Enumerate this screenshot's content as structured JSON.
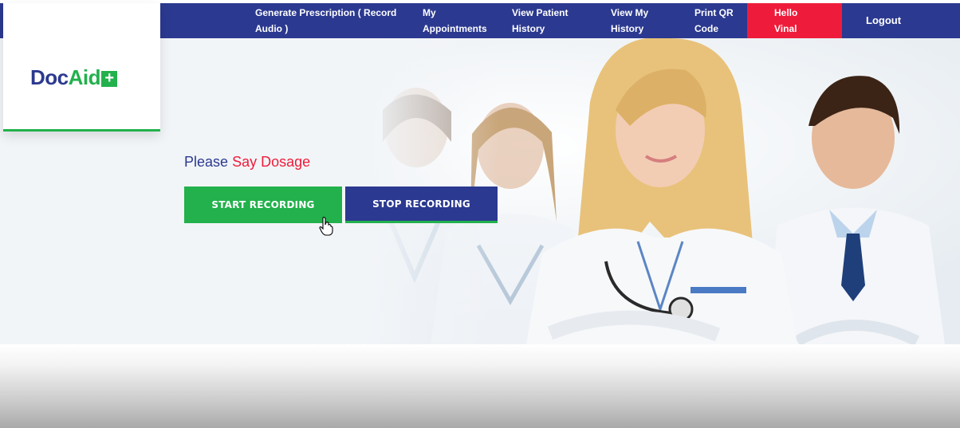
{
  "nav": {
    "items": [
      {
        "label_line1": "Generate Prescription ( Record",
        "label_line2": "Audio )"
      },
      {
        "label_line1": "My",
        "label_line2": "Appointments"
      },
      {
        "label_line1": "View Patient",
        "label_line2": "History"
      },
      {
        "label_line1": "View My",
        "label_line2": "History"
      },
      {
        "label_line1": "Print QR",
        "label_line2": "Code"
      }
    ],
    "greeting_line1": "Hello",
    "greeting_line2": "Vinal",
    "logout": "Logout"
  },
  "logo": {
    "doc": "Doc",
    "aid": "Aid",
    "plus": "+"
  },
  "hero": {
    "prompt_prefix": "Please",
    "prompt_accent": "Say Dosage",
    "start_button": "START RECORDING",
    "stop_button": "STOP RECORDING"
  },
  "colors": {
    "brand_blue": "#2b3990",
    "brand_green": "#22b14c",
    "accent_red": "#ee1c3a"
  },
  "icons": [
    "pointer-hand-icon",
    "plus-icon"
  ]
}
